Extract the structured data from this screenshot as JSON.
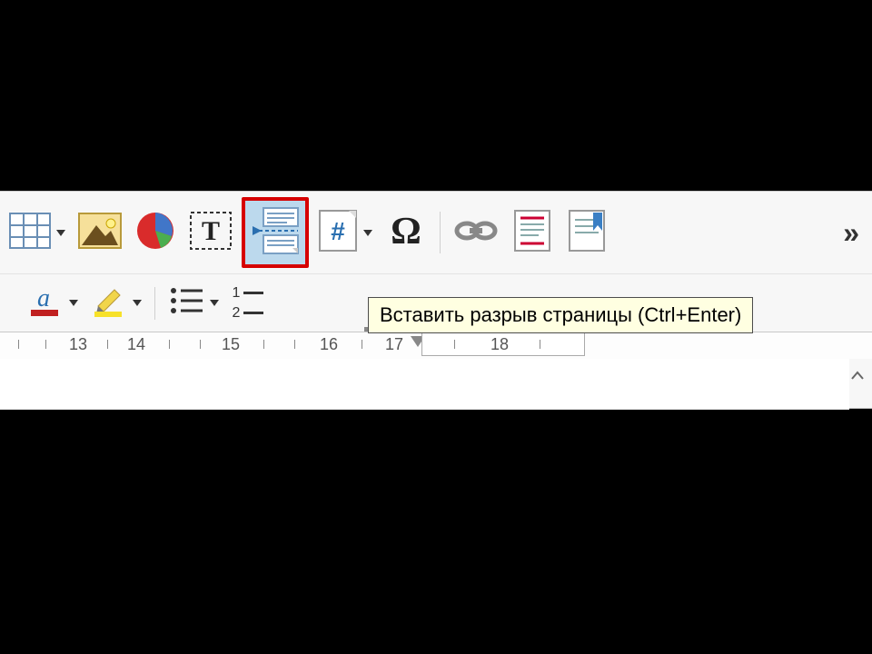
{
  "tooltip": {
    "text": "Вставить разрыв страницы (Ctrl+Enter)"
  },
  "ruler": {
    "ticks": [
      "13",
      "14",
      "15",
      "16",
      "17",
      "18"
    ]
  },
  "row2": {
    "num_list_1": "1",
    "num_list_2": "2"
  },
  "overflow": "»"
}
